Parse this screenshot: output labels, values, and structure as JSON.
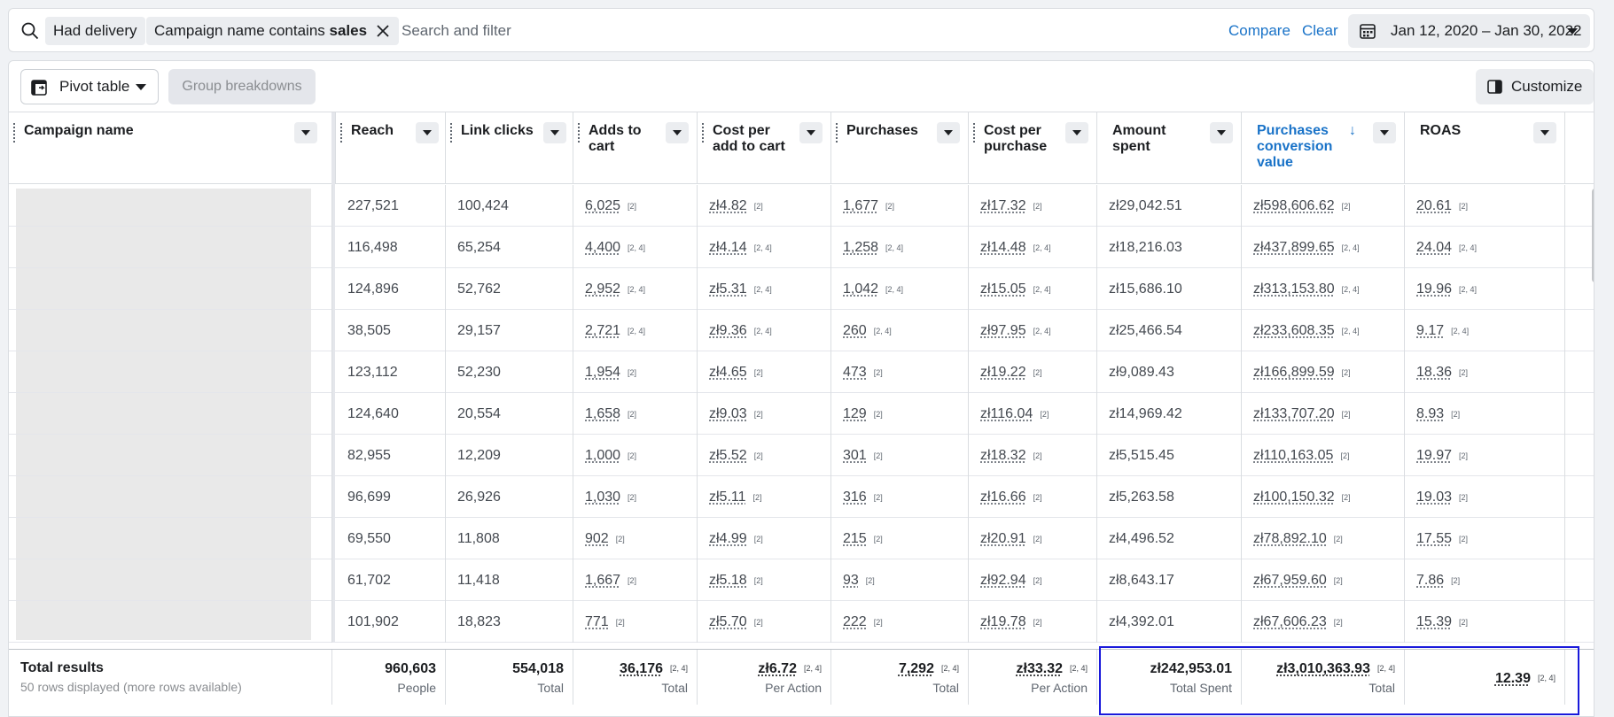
{
  "filter_bar": {
    "chips": [
      {
        "label": "Had delivery"
      },
      {
        "prefix": "Campaign name contains ",
        "bold": "sales"
      }
    ],
    "search_placeholder": "Search and filter",
    "compare_label": "Compare",
    "clear_label": "Clear",
    "date_range": "Jan 12, 2020 – Jan 30, 2022"
  },
  "toolbar": {
    "pivot_label": "Pivot table",
    "group_label": "Group breakdowns",
    "customize_label": "Customize"
  },
  "columns": [
    {
      "label": "Campaign name"
    },
    {
      "label": "Reach"
    },
    {
      "label": "Link clicks"
    },
    {
      "label": "Adds to cart"
    },
    {
      "label": "Cost per add to cart"
    },
    {
      "label": "Purchases"
    },
    {
      "label": "Cost per purchase"
    },
    {
      "label": "Amount spent"
    },
    {
      "label": "Purchases conversion value",
      "sort": "↓"
    },
    {
      "label": "ROAS"
    }
  ],
  "rows": [
    {
      "reach": "227,521",
      "clicks": "100,424",
      "atc": "6,025",
      "atc_fn": "[2]",
      "cpatc": "zł4.82",
      "cpatc_fn": "[2]",
      "purch": "1,677",
      "purch_fn": "[2]",
      "cpp": "zł17.32",
      "cpp_fn": "[2]",
      "spent": "zł29,042.51",
      "pcv": "zł598,606.62",
      "pcv_fn": "[2]",
      "roas": "20.61",
      "roas_fn": "[2]"
    },
    {
      "reach": "116,498",
      "clicks": "65,254",
      "atc": "4,400",
      "atc_fn": "[2, 4]",
      "cpatc": "zł4.14",
      "cpatc_fn": "[2, 4]",
      "purch": "1,258",
      "purch_fn": "[2, 4]",
      "cpp": "zł14.48",
      "cpp_fn": "[2, 4]",
      "spent": "zł18,216.03",
      "pcv": "zł437,899.65",
      "pcv_fn": "[2, 4]",
      "roas": "24.04",
      "roas_fn": "[2, 4]"
    },
    {
      "reach": "124,896",
      "clicks": "52,762",
      "atc": "2,952",
      "atc_fn": "[2, 4]",
      "cpatc": "zł5.31",
      "cpatc_fn": "[2, 4]",
      "purch": "1,042",
      "purch_fn": "[2, 4]",
      "cpp": "zł15.05",
      "cpp_fn": "[2, 4]",
      "spent": "zł15,686.10",
      "pcv": "zł313,153.80",
      "pcv_fn": "[2, 4]",
      "roas": "19.96",
      "roas_fn": "[2, 4]"
    },
    {
      "reach": "38,505",
      "clicks": "29,157",
      "atc": "2,721",
      "atc_fn": "[2, 4]",
      "cpatc": "zł9.36",
      "cpatc_fn": "[2, 4]",
      "purch": "260",
      "purch_fn": "[2, 4]",
      "cpp": "zł97.95",
      "cpp_fn": "[2, 4]",
      "spent": "zł25,466.54",
      "pcv": "zł233,608.35",
      "pcv_fn": "[2, 4]",
      "roas": "9.17",
      "roas_fn": "[2, 4]"
    },
    {
      "reach": "123,112",
      "clicks": "52,230",
      "atc": "1,954",
      "atc_fn": "[2]",
      "cpatc": "zł4.65",
      "cpatc_fn": "[2]",
      "purch": "473",
      "purch_fn": "[2]",
      "cpp": "zł19.22",
      "cpp_fn": "[2]",
      "spent": "zł9,089.43",
      "pcv": "zł166,899.59",
      "pcv_fn": "[2]",
      "roas": "18.36",
      "roas_fn": "[2]"
    },
    {
      "reach": "124,640",
      "clicks": "20,554",
      "atc": "1,658",
      "atc_fn": "[2]",
      "cpatc": "zł9.03",
      "cpatc_fn": "[2]",
      "purch": "129",
      "purch_fn": "[2]",
      "cpp": "zł116.04",
      "cpp_fn": "[2]",
      "spent": "zł14,969.42",
      "pcv": "zł133,707.20",
      "pcv_fn": "[2]",
      "roas": "8.93",
      "roas_fn": "[2]"
    },
    {
      "reach": "82,955",
      "clicks": "12,209",
      "atc": "1,000",
      "atc_fn": "[2]",
      "cpatc": "zł5.52",
      "cpatc_fn": "[2]",
      "purch": "301",
      "purch_fn": "[2]",
      "cpp": "zł18.32",
      "cpp_fn": "[2]",
      "spent": "zł5,515.45",
      "pcv": "zł110,163.05",
      "pcv_fn": "[2]",
      "roas": "19.97",
      "roas_fn": "[2]"
    },
    {
      "reach": "96,699",
      "clicks": "26,926",
      "atc": "1,030",
      "atc_fn": "[2]",
      "cpatc": "zł5.11",
      "cpatc_fn": "[2]",
      "purch": "316",
      "purch_fn": "[2]",
      "cpp": "zł16.66",
      "cpp_fn": "[2]",
      "spent": "zł5,263.58",
      "pcv": "zł100,150.32",
      "pcv_fn": "[2]",
      "roas": "19.03",
      "roas_fn": "[2]"
    },
    {
      "reach": "69,550",
      "clicks": "11,808",
      "atc": "902",
      "atc_fn": "[2]",
      "cpatc": "zł4.99",
      "cpatc_fn": "[2]",
      "purch": "215",
      "purch_fn": "[2]",
      "cpp": "zł20.91",
      "cpp_fn": "[2]",
      "spent": "zł4,496.52",
      "pcv": "zł78,892.10",
      "pcv_fn": "[2]",
      "roas": "17.55",
      "roas_fn": "[2]"
    },
    {
      "reach": "61,702",
      "clicks": "11,418",
      "atc": "1,667",
      "atc_fn": "[2]",
      "cpatc": "zł5.18",
      "cpatc_fn": "[2]",
      "purch": "93",
      "purch_fn": "[2]",
      "cpp": "zł92.94",
      "cpp_fn": "[2]",
      "spent": "zł8,643.17",
      "pcv": "zł67,959.60",
      "pcv_fn": "[2]",
      "roas": "7.86",
      "roas_fn": "[2]"
    },
    {
      "reach": "101,902",
      "clicks": "18,823",
      "atc": "771",
      "atc_fn": "[2]",
      "cpatc": "zł5.70",
      "cpatc_fn": "[2]",
      "purch": "222",
      "purch_fn": "[2]",
      "cpp": "zł19.78",
      "cpp_fn": "[2]",
      "spent": "zł4,392.01",
      "pcv": "zł67,606.23",
      "pcv_fn": "[2]",
      "roas": "15.39",
      "roas_fn": "[2]"
    }
  ],
  "totals": {
    "title": "Total results",
    "subtitle": "50 rows displayed (more rows available)",
    "reach": {
      "value": "960,603",
      "sub": "People"
    },
    "clicks": {
      "value": "554,018",
      "sub": "Total"
    },
    "atc": {
      "value": "36,176",
      "fn": "[2, 4]",
      "sub": "Total"
    },
    "cpatc": {
      "value": "zł6.72",
      "fn": "[2, 4]",
      "sub": "Per Action"
    },
    "purch": {
      "value": "7,292",
      "fn": "[2, 4]",
      "sub": "Total"
    },
    "cpp": {
      "value": "zł33.32",
      "fn": "[2, 4]",
      "sub": "Per Action"
    },
    "spent": {
      "value": "zł242,953.01",
      "sub": "Total Spent"
    },
    "pcv": {
      "value": "zł3,010,363.93",
      "fn": "[2, 4]",
      "sub": "Total"
    },
    "roas": {
      "value": "12.39",
      "fn": "[2, 4]"
    }
  },
  "colors": {
    "accent": "#1a73c8",
    "highlight": "#1a1adb"
  }
}
